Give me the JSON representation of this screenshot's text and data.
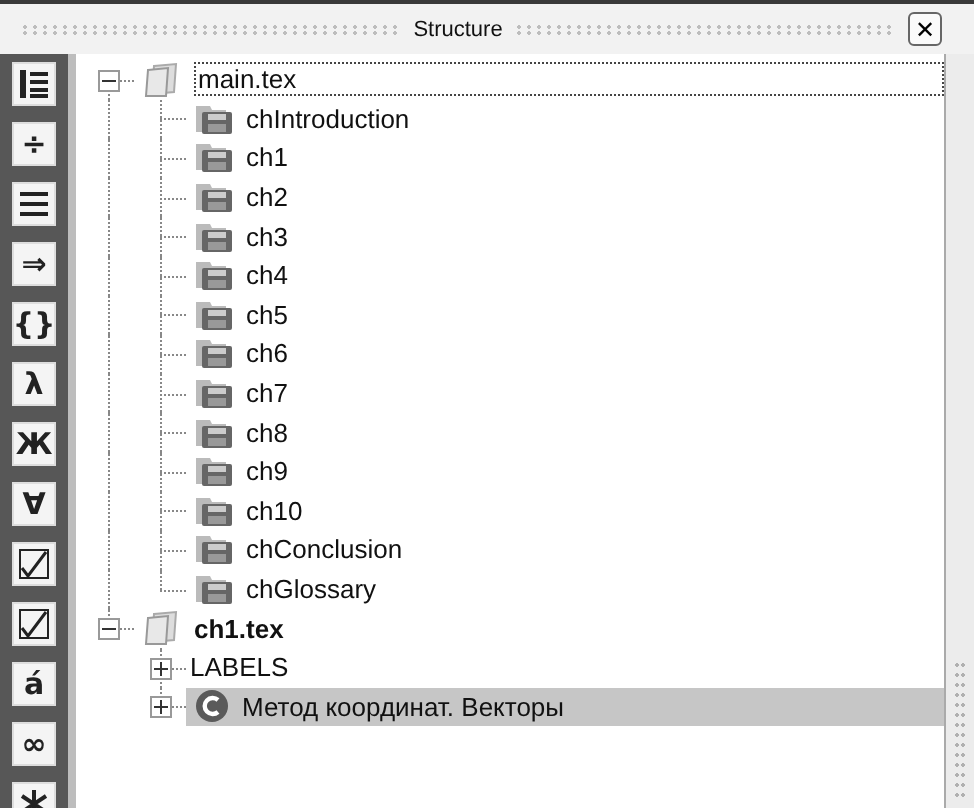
{
  "panel": {
    "title": "Structure",
    "close_label": "✕"
  },
  "toolbar": [
    {
      "kind": "list"
    },
    {
      "kind": "glyph",
      "glyph": "÷"
    },
    {
      "kind": "lines"
    },
    {
      "kind": "glyph",
      "glyph": "⇒"
    },
    {
      "kind": "glyph",
      "glyph": "{}"
    },
    {
      "kind": "glyph",
      "glyph": "λ"
    },
    {
      "kind": "glyph",
      "glyph": "Ж"
    },
    {
      "kind": "glyph",
      "glyph": "∀"
    },
    {
      "kind": "root"
    },
    {
      "kind": "root"
    },
    {
      "kind": "glyph",
      "glyph": "á"
    },
    {
      "kind": "glyph",
      "glyph": "∞"
    },
    {
      "kind": "star"
    }
  ],
  "tree": [
    {
      "label": "main.tex",
      "kind": "file",
      "expanded": true,
      "focused": true,
      "current": false,
      "selected": false,
      "children": [
        {
          "label": "chIntroduction",
          "kind": "chapter",
          "selected": false
        },
        {
          "label": "ch1",
          "kind": "chapter",
          "selected": false
        },
        {
          "label": "ch2",
          "kind": "chapter",
          "selected": false
        },
        {
          "label": "ch3",
          "kind": "chapter",
          "selected": false
        },
        {
          "label": "ch4",
          "kind": "chapter",
          "selected": false
        },
        {
          "label": "ch5",
          "kind": "chapter",
          "selected": false
        },
        {
          "label": "ch6",
          "kind": "chapter",
          "selected": false
        },
        {
          "label": "ch7",
          "kind": "chapter",
          "selected": false
        },
        {
          "label": "ch8",
          "kind": "chapter",
          "selected": false
        },
        {
          "label": "ch9",
          "kind": "chapter",
          "selected": false
        },
        {
          "label": "ch10",
          "kind": "chapter",
          "selected": false
        },
        {
          "label": "chConclusion",
          "kind": "chapter",
          "selected": false
        },
        {
          "label": "chGlossary",
          "kind": "chapter",
          "selected": false
        }
      ]
    },
    {
      "label": "ch1.tex",
      "kind": "file",
      "expanded": true,
      "focused": false,
      "current": true,
      "selected": false,
      "children": [
        {
          "label": "LABELS",
          "kind": "group",
          "expanded": false,
          "selected": false
        },
        {
          "label": "Метод координат. Векторы",
          "kind": "section",
          "expanded": false,
          "selected": true
        }
      ]
    }
  ]
}
